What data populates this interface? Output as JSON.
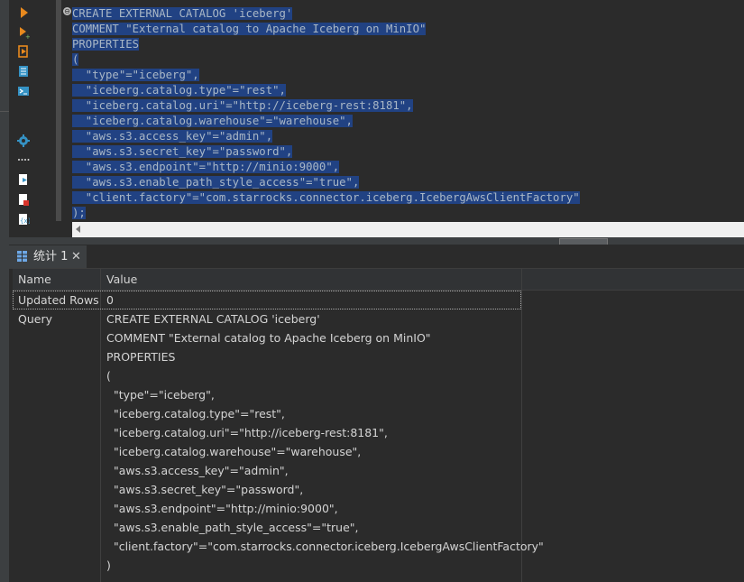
{
  "editor": {
    "fold_marker": "⊖",
    "lines": [
      "CREATE EXTERNAL CATALOG 'iceberg'",
      "COMMENT \"External catalog to Apache Iceberg on MinIO\"",
      "PROPERTIES",
      "(",
      "  \"type\"=\"iceberg\",",
      "  \"iceberg.catalog.type\"=\"rest\",",
      "  \"iceberg.catalog.uri\"=\"http://iceberg-rest:8181\",",
      "  \"iceberg.catalog.warehouse\"=\"warehouse\",",
      "  \"aws.s3.access_key\"=\"admin\",",
      "  \"aws.s3.secret_key\"=\"password\",",
      "  \"aws.s3.endpoint\"=\"http://minio:9000\",",
      "  \"aws.s3.enable_path_style_access\"=\"true\",",
      "  \"client.factory\"=\"com.starrocks.connector.iceberg.IcebergAwsClientFactory\"",
      ");"
    ]
  },
  "toolbar": {
    "icons": [
      "execute-statement-icon",
      "execute-new-tab-icon",
      "execute-script-icon",
      "execute-script-new-tab-icon",
      "open-console-icon",
      "settings-icon",
      "more-icon",
      "export-icon",
      "import-icon",
      "format-icon"
    ]
  },
  "results_tab": {
    "label": "统计 1",
    "close": "✕"
  },
  "results": {
    "columns": [
      "Name",
      "Value"
    ],
    "rows": [
      {
        "name": "Updated Rows",
        "value_lines": [
          "0"
        ]
      },
      {
        "name": "Query",
        "value_lines": [
          "CREATE EXTERNAL CATALOG 'iceberg'",
          "COMMENT \"External catalog to Apache Iceberg on MinIO\"",
          "PROPERTIES",
          "(",
          "  \"type\"=\"iceberg\",",
          "  \"iceberg.catalog.type\"=\"rest\",",
          "  \"iceberg.catalog.uri\"=\"http://iceberg-rest:8181\",",
          "  \"iceberg.catalog.warehouse\"=\"warehouse\",",
          "  \"aws.s3.access_key\"=\"admin\",",
          "  \"aws.s3.secret_key\"=\"password\",",
          "  \"aws.s3.endpoint\"=\"http://minio:9000\",",
          "  \"aws.s3.enable_path_style_access\"=\"true\",",
          "  \"client.factory\"=\"com.starrocks.connector.iceberg.IcebergAwsClientFactory\"",
          ")"
        ]
      }
    ]
  },
  "colors": {
    "selection": "#214283",
    "selection_text": "#a9b7c6",
    "accent_orange": "#e8891e",
    "accent_blue": "#3592c4"
  }
}
